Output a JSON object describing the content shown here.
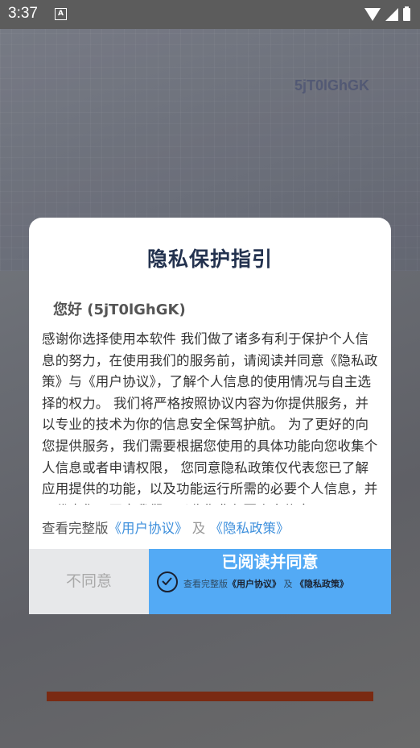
{
  "status_bar": {
    "time": "3:37",
    "notification_icon": "A"
  },
  "background": {
    "partial_text": "5jT0lGhGK",
    "accent_bar_color": "#7a2a12"
  },
  "dialog": {
    "title": "隐私保护指引",
    "greeting": "您好 (5jT0lGhGK)",
    "body": "感谢你选择使用本软件 我们做了诸多有利于保护个人信息的努力，在使用我们的服务前，请阅读并同意《隐私政策》与《用户协议》，了解个人信息的使用情况与自主选择的权力。 我们将严格按照协议内容为你提供服务，并以专业的技术为你的信息安全保驾护航。 为了更好的向您提供服务，我们需要根据您使用的具体功能向您收集个人信息或者申请权限， 您同意隐私政策仅代表您已了解应用提供的功能，以及功能运行所需的必要个人信息，并不代表您已同意我们可以收集非必要个人信息。",
    "links_prefix": "查看完整版",
    "user_agreement_link": "《用户协议》",
    "links_separator": "及",
    "privacy_policy_link": "《隐私政策》",
    "disagree_label": "不同意",
    "agree_label": "已阅读并同意",
    "agree_sub_prefix": "查看完整版",
    "agree_sub_user_agreement": "《用户协议》",
    "agree_sub_separator": "及",
    "agree_sub_privacy_policy": "《隐私政策》",
    "colors": {
      "title": "#23324f",
      "link": "#3d8fdc",
      "agree_button": "#53aaf5",
      "disagree_button": "#e7e8ea"
    }
  }
}
